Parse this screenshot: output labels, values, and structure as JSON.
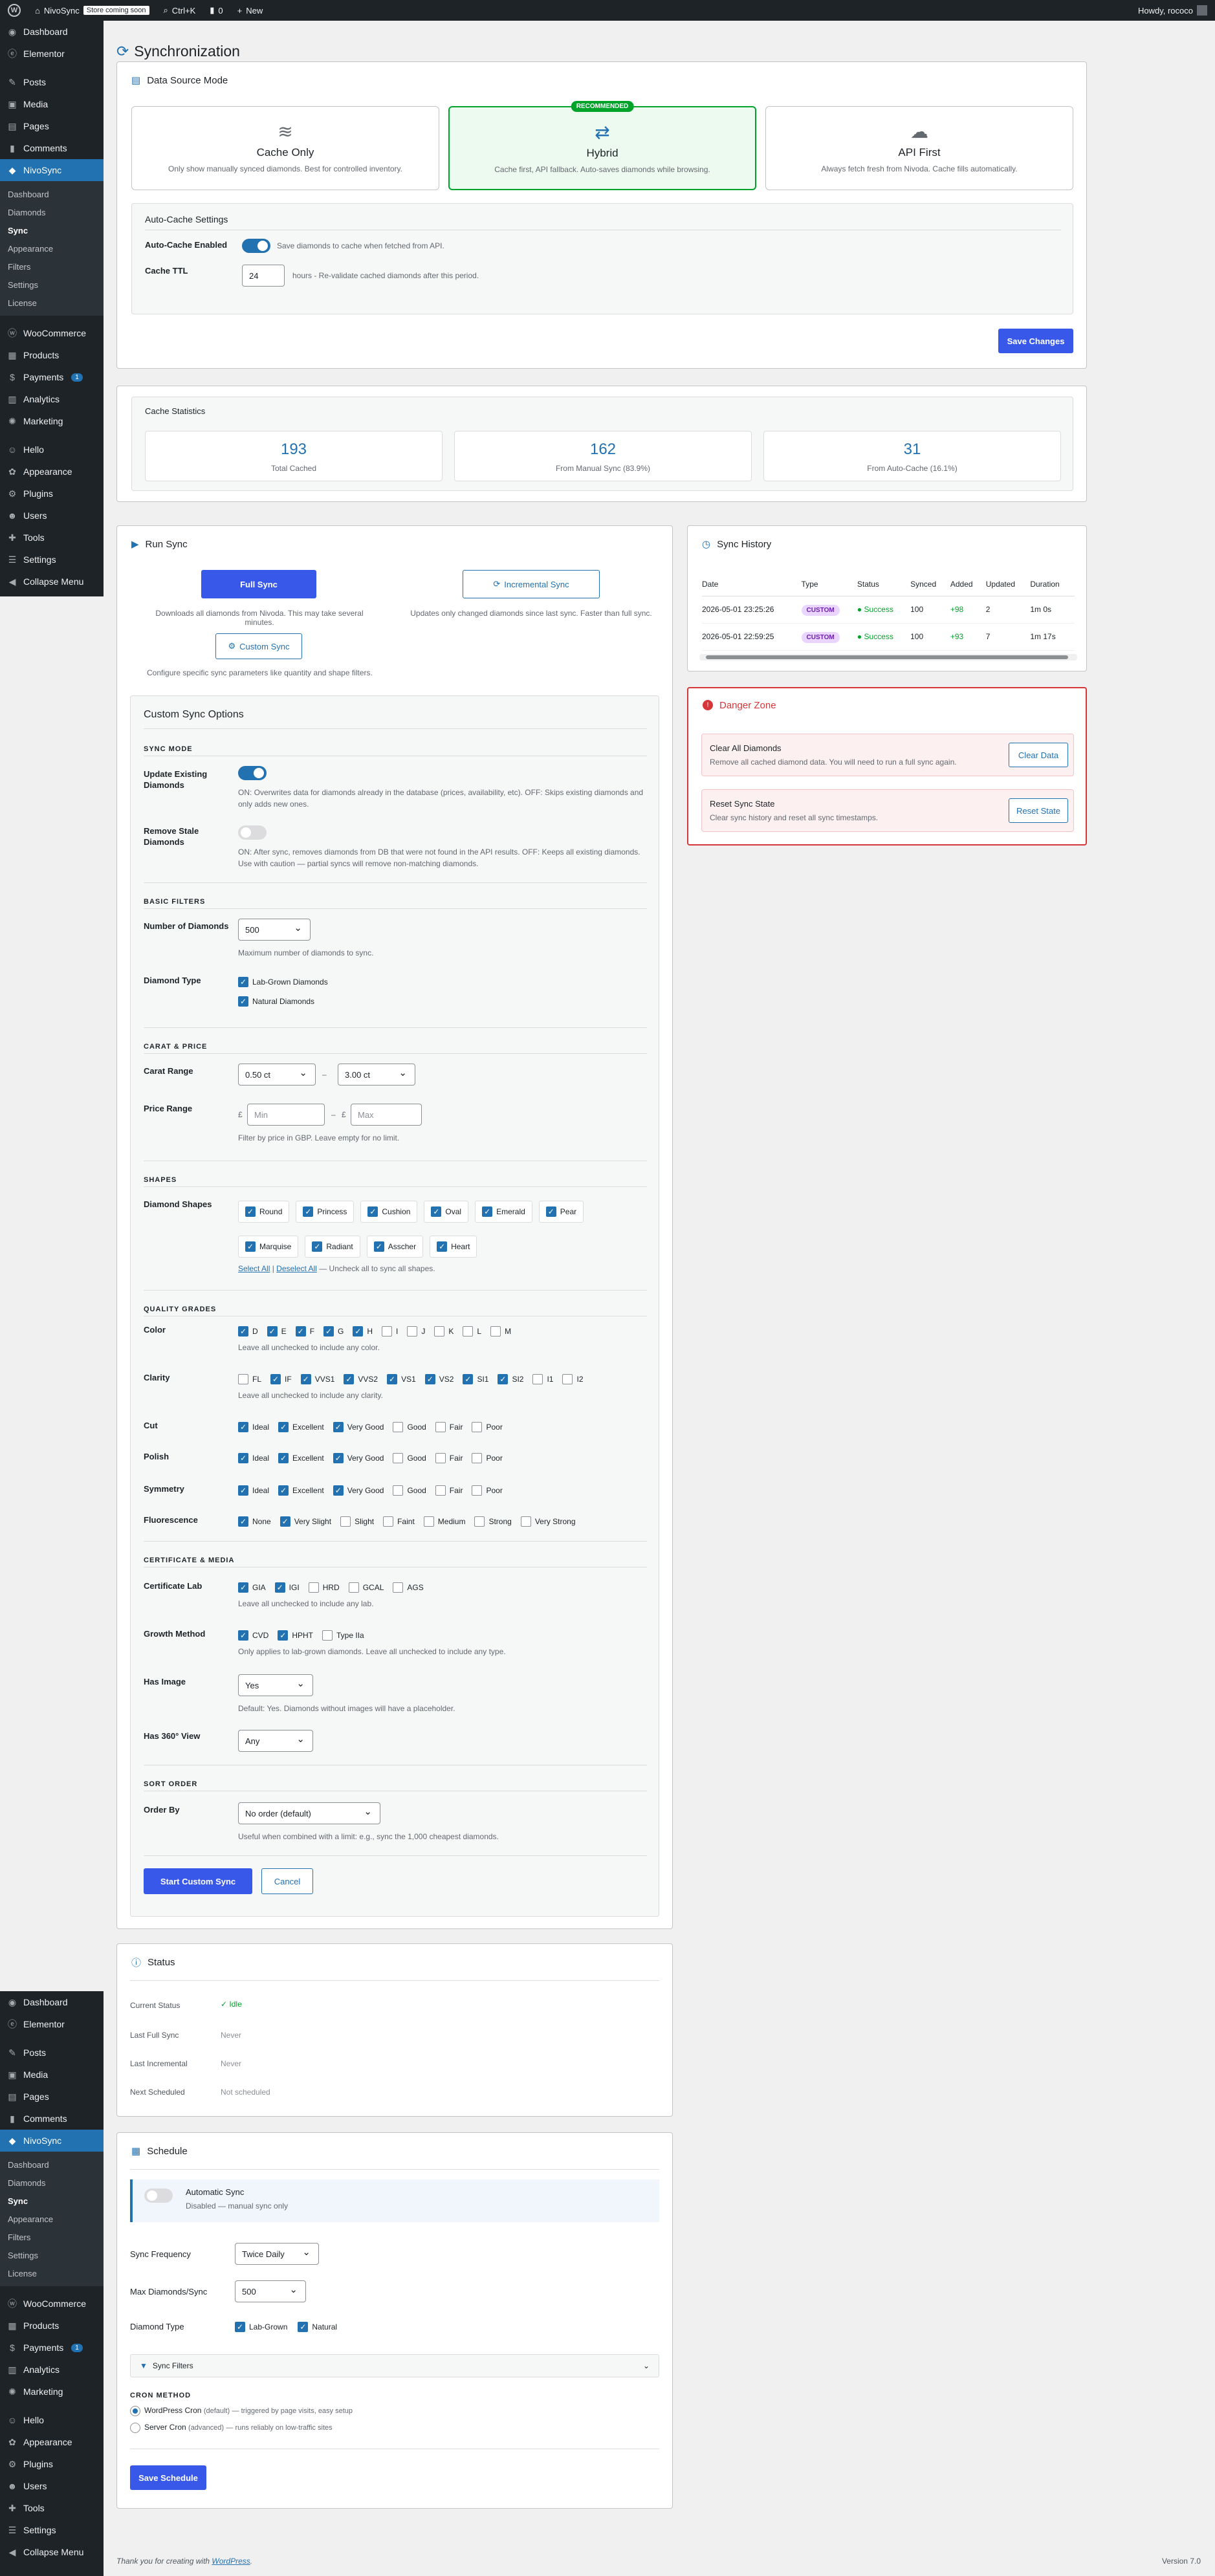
{
  "adminbar": {
    "site": "NivoSync",
    "badge": "Store coming soon",
    "shortcut": "Ctrl+K",
    "comments": "0",
    "new": "New",
    "howdy": "Howdy, rococo"
  },
  "menu": {
    "top": [
      "Dashboard",
      "Elementor"
    ],
    "group2": [
      "Posts",
      "Media",
      "Pages",
      "Comments"
    ],
    "plugin": "NivoSync",
    "sub": [
      "Dashboard",
      "Diamonds",
      "Sync",
      "Appearance",
      "Filters",
      "Settings",
      "License"
    ],
    "group3": [
      "WooCommerce",
      "Products",
      "Payments",
      "Analytics",
      "Marketing"
    ],
    "payments_count": "1",
    "group4": [
      "Hello",
      "Appearance",
      "Plugins",
      "Users",
      "Tools",
      "Settings",
      "Collapse Menu"
    ]
  },
  "page_title": "Synchronization",
  "datasource": {
    "title": "Data Source Mode",
    "modes": [
      {
        "name": "Cache Only",
        "desc": "Only show manually synced diamonds. Best for controlled inventory.",
        "icon": "database-icon"
      },
      {
        "name": "Hybrid",
        "desc": "Cache first, API fallback. Auto-saves diamonds while browsing.",
        "icon": "shuffle-icon",
        "badge": "RECOMMENDED"
      },
      {
        "name": "API First",
        "desc": "Always fetch fresh from Nivoda. Cache fills automatically.",
        "icon": "cloud-icon"
      }
    ],
    "autocache_title": "Auto-Cache Settings",
    "autocache_label": "Auto-Cache Enabled",
    "autocache_desc": "Save diamonds to cache when fetched from API.",
    "ttl_label": "Cache TTL",
    "ttl_value": "24",
    "ttl_desc": "hours - Re-validate cached diamonds after this period.",
    "save": "Save Changes"
  },
  "stats": {
    "title": "Cache Statistics",
    "items": [
      {
        "value": "193",
        "label": "Total Cached"
      },
      {
        "value": "162",
        "label": "From Manual Sync (83.9%)"
      },
      {
        "value": "31",
        "label": "From Auto-Cache (16.1%)"
      }
    ]
  },
  "runsync": {
    "title": "Run Sync",
    "full": "Full Sync",
    "full_desc": "Downloads all diamonds from Nivoda. This may take several minutes.",
    "incr": "Incremental Sync",
    "incr_desc": "Updates only changed diamonds since last sync. Faster than full sync.",
    "custom": "Custom Sync",
    "custom_desc": "Configure specific sync parameters like quantity and shape filters.",
    "options_title": "Custom Sync Options",
    "sync_mode": "SYNC MODE",
    "update_label": "Update Existing Diamonds",
    "update_desc": "ON: Overwrites data for diamonds already in the database (prices, availability, etc). OFF: Skips existing diamonds and only adds new ones.",
    "stale_label": "Remove Stale Diamonds",
    "stale_desc": "ON: After sync, removes diamonds from DB that were not found in the API results. OFF: Keeps all existing diamonds. Use with caution — partial syncs will remove non-matching diamonds.",
    "basic": "BASIC FILTERS",
    "num_label": "Number of Diamonds",
    "num_value": "500",
    "num_desc": "Maximum number of diamonds to sync.",
    "type_label": "Diamond Type",
    "type_opts": [
      "Lab-Grown Diamonds",
      "Natural Diamonds"
    ],
    "carat_sec": "CARAT & PRICE",
    "carat_label": "Carat Range",
    "carat_min": "0.50 ct",
    "carat_max": "3.00 ct",
    "dash": "–",
    "price_label": "Price Range",
    "currency": "£",
    "min_ph": "Min",
    "max_ph": "Max",
    "price_desc": "Filter by price in GBP. Leave empty for no limit.",
    "shapes_sec": "SHAPES",
    "shapes_label": "Diamond Shapes",
    "shapes1": [
      "Round",
      "Princess",
      "Cushion",
      "Oval",
      "Emerald",
      "Pear"
    ],
    "shapes2": [
      "Marquise",
      "Radiant",
      "Asscher",
      "Heart"
    ],
    "select_all": "Select All",
    "deselect_all": "Deselect All",
    "shapes_note": "— Uncheck all to sync all shapes.",
    "quality_sec": "QUALITY GRADES",
    "color_label": "Color",
    "colors": [
      "D",
      "E",
      "F",
      "G",
      "H",
      "I",
      "J",
      "K",
      "L",
      "M"
    ],
    "colors_on": 5,
    "color_note": "Leave all unchecked to include any color.",
    "clarity_label": "Clarity",
    "clarities": [
      "FL",
      "IF",
      "VVS1",
      "VVS2",
      "VS1",
      "VS2",
      "SI1",
      "SI2",
      "I1",
      "I2"
    ],
    "clarity_note": "Leave all unchecked to include any clarity.",
    "cut_label": "Cut",
    "polish_label": "Polish",
    "symmetry_label": "Symmetry",
    "grades": [
      "Ideal",
      "Excellent",
      "Very Good",
      "Good",
      "Fair",
      "Poor"
    ],
    "fluor_label": "Fluorescence",
    "fluors": [
      "None",
      "Very Slight",
      "Slight",
      "Faint",
      "Medium",
      "Strong",
      "Very Strong"
    ],
    "cert_sec": "CERTIFICATE & MEDIA",
    "lab_label": "Certificate Lab",
    "labs": [
      "GIA",
      "IGI",
      "HRD",
      "GCAL",
      "AGS"
    ],
    "lab_note": "Leave all unchecked to include any lab.",
    "growth_label": "Growth Method",
    "growth": [
      "CVD",
      "HPHT",
      "Type IIa"
    ],
    "growth_note": "Only applies to lab-grown diamonds. Leave all unchecked to include any type.",
    "image_label": "Has Image",
    "image_value": "Yes",
    "image_note": "Default: Yes. Diamonds without images will have a placeholder.",
    "v360_label": "Has 360° View",
    "v360_value": "Any",
    "sort_sec": "SORT ORDER",
    "order_label": "Order By",
    "order_value": "No order (default)",
    "order_note": "Useful when combined with a limit: e.g., sync the 1,000 cheapest diamonds.",
    "start": "Start Custom Sync",
    "cancel": "Cancel"
  },
  "history": {
    "title": "Sync History",
    "cols": [
      "Date",
      "Type",
      "Status",
      "Synced",
      "Added",
      "Updated",
      "Duration"
    ],
    "rows": [
      [
        "2026-05-01 23:25:26",
        "CUSTOM",
        "Success",
        "100",
        "+98",
        "2",
        "1m 0s"
      ],
      [
        "2026-05-01 22:59:25",
        "CUSTOM",
        "Success",
        "100",
        "+93",
        "7",
        "1m 17s"
      ]
    ]
  },
  "danger": {
    "title": "Danger Zone",
    "clear_title": "Clear All Diamonds",
    "clear_desc": "Remove all cached diamond data. You will need to run a full sync again.",
    "clear_btn": "Clear Data",
    "reset_title": "Reset Sync State",
    "reset_desc": "Clear sync history and reset all sync timestamps.",
    "reset_btn": "Reset State"
  },
  "status": {
    "title": "Status",
    "rows": [
      {
        "k": "Current Status",
        "v": "Idle"
      },
      {
        "k": "Last Full Sync",
        "v": "Never"
      },
      {
        "k": "Last Incremental",
        "v": "Never"
      },
      {
        "k": "Next Scheduled",
        "v": "Not scheduled"
      }
    ]
  },
  "schedule": {
    "title": "Schedule",
    "auto_label": "Automatic Sync",
    "auto_desc": "Disabled — manual sync only",
    "freq_label": "Sync Frequency",
    "freq_value": "Twice Daily",
    "max_label": "Max Diamonds/Sync",
    "max_value": "500",
    "type_label": "Diamond Type",
    "types": [
      "Lab-Grown",
      "Natural"
    ],
    "filters": "Sync Filters",
    "cron_title": "CRON METHOD",
    "cron_wp": "WordPress Cron",
    "cron_wp_tag": "(default)",
    "cron_wp_desc": "— triggered by page visits, easy setup",
    "cron_srv": "Server Cron",
    "cron_srv_tag": "(advanced)",
    "cron_srv_desc": "— runs reliably on low-traffic sites",
    "save": "Save Schedule"
  },
  "footer": {
    "text": "Thank you for creating with",
    "link": "WordPress",
    "version": "Version 7.0"
  },
  "colors": {
    "accent": "#2271b1",
    "success": "#00a32a",
    "danger": "#d63638",
    "primary_btn": "#3858e9"
  }
}
